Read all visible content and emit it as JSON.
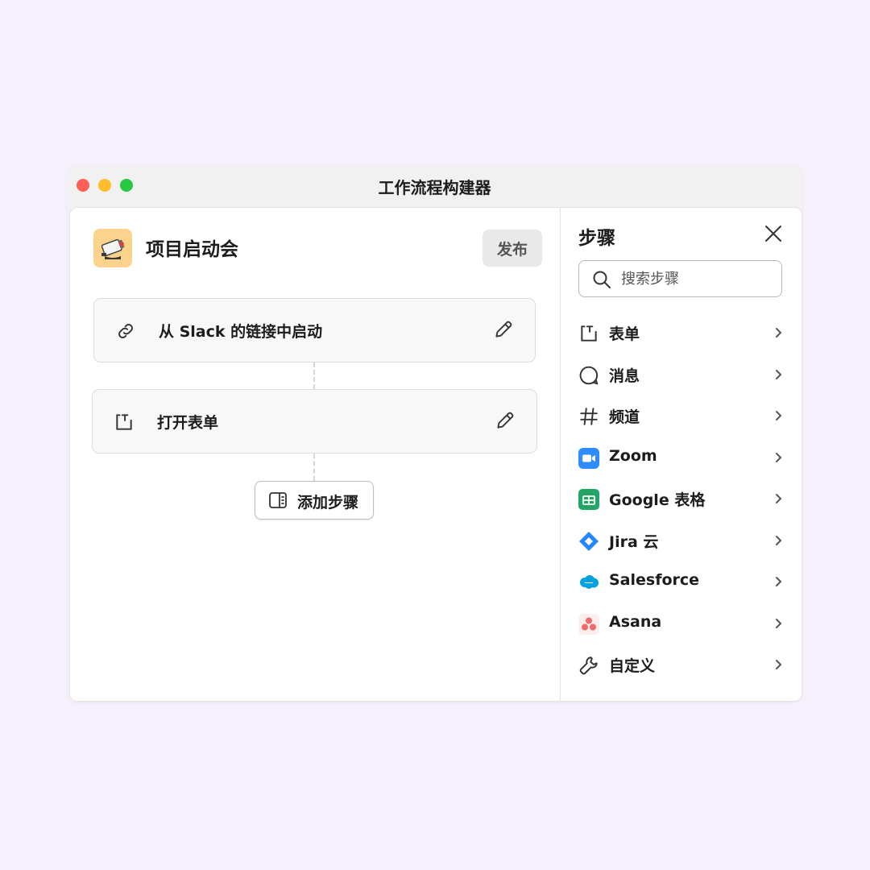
{
  "window": {
    "title": "工作流程构建器"
  },
  "workflow": {
    "title": "项目启动会",
    "publish_label": "发布",
    "steps": [
      {
        "label": "从 Slack 的链接中启动",
        "icon": "link-icon"
      },
      {
        "label": "打开表单",
        "icon": "form-icon"
      }
    ],
    "add_step_label": "添加步骤"
  },
  "sidebar": {
    "title": "步骤",
    "search_placeholder": "搜索步骤",
    "items": [
      {
        "label": "表单",
        "icon": "form-icon"
      },
      {
        "label": "消息",
        "icon": "message-icon"
      },
      {
        "label": "频道",
        "icon": "hash-icon"
      },
      {
        "label": "Zoom",
        "icon": "zoom-icon"
      },
      {
        "label": "Google 表格",
        "icon": "google-sheets-icon"
      },
      {
        "label": "Jira 云",
        "icon": "jira-icon"
      },
      {
        "label": "Salesforce",
        "icon": "salesforce-icon"
      },
      {
        "label": "Asana",
        "icon": "asana-icon"
      },
      {
        "label": "自定义",
        "icon": "wrench-icon"
      }
    ]
  },
  "colors": {
    "background": "#f6f0fc",
    "zoom": "#2d8cff",
    "google_sheets": "#23a566",
    "jira": "#2684ff",
    "salesforce": "#00a1e0",
    "asana": "#f06a6a"
  }
}
